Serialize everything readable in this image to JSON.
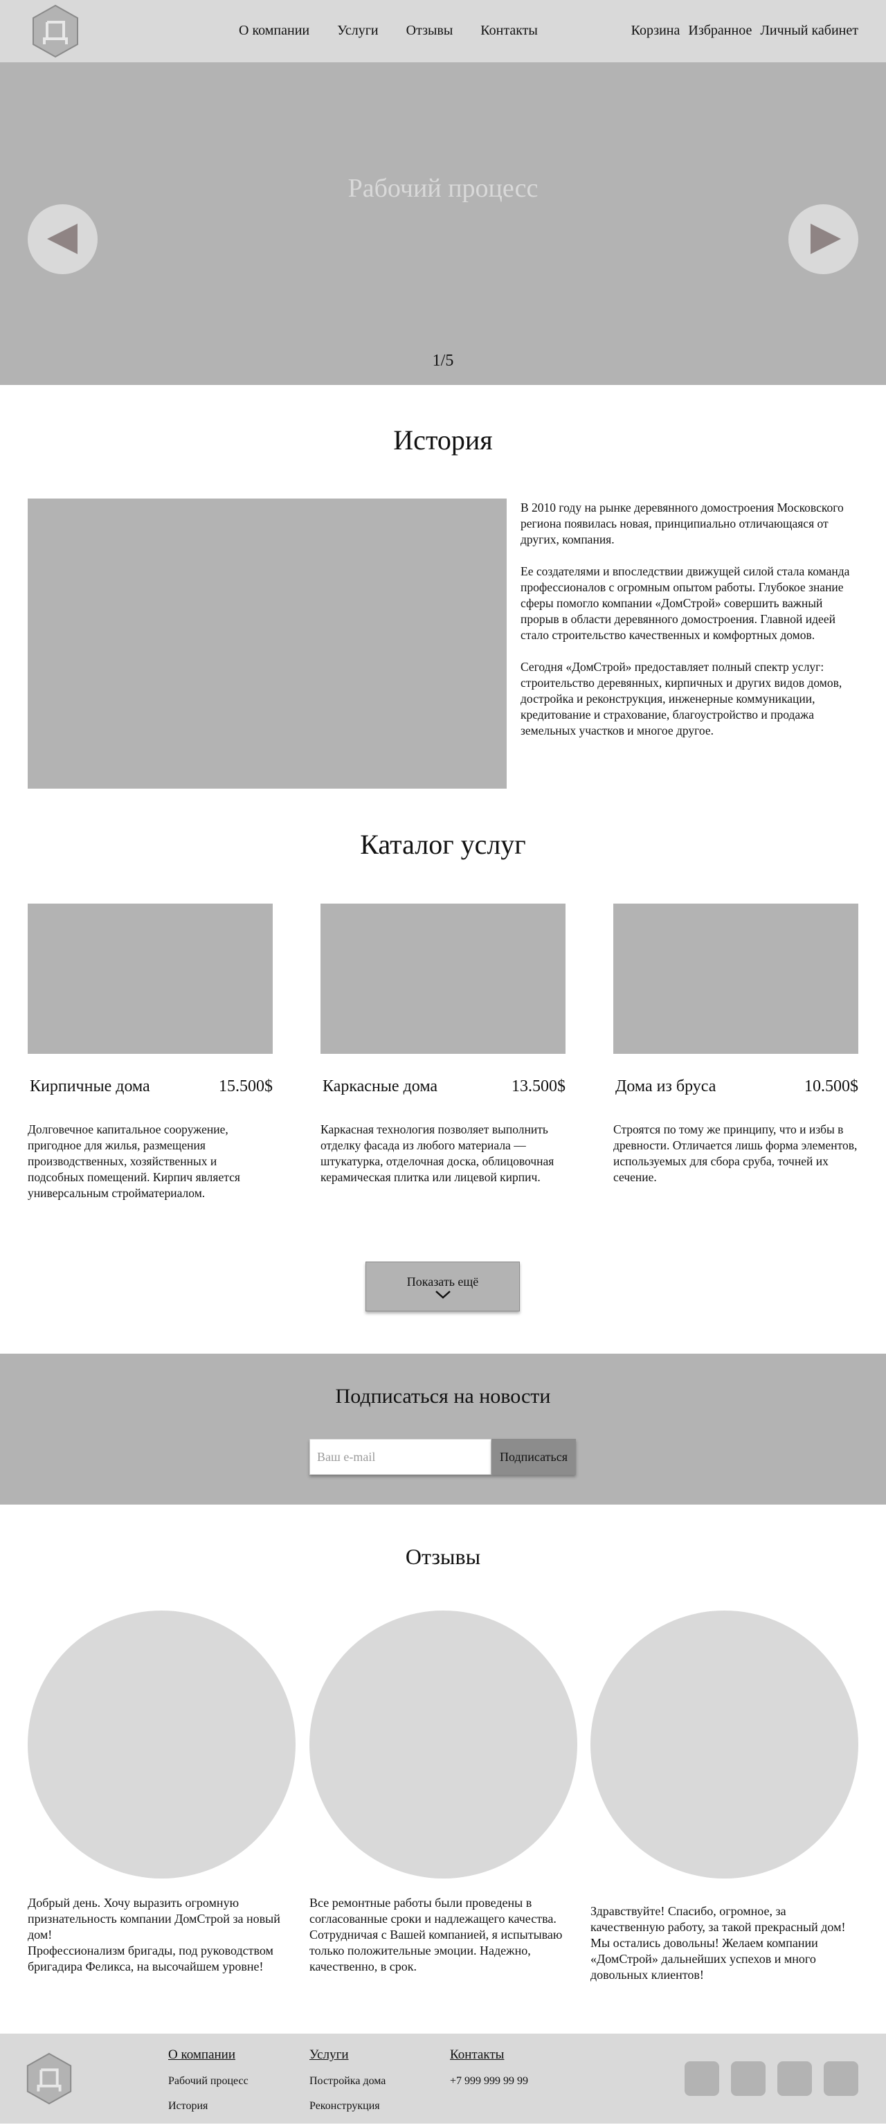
{
  "header": {
    "nav": [
      "О компании",
      "Услуги",
      "Отзывы",
      "Контакты"
    ],
    "user_links": [
      "Корзина",
      "Избранное",
      "Личный кабинет"
    ]
  },
  "hero": {
    "title": "Рабочий процесс",
    "counter": "1/5"
  },
  "history": {
    "title": "История",
    "paragraphs": [
      "В 2010 году на рынке деревянного домостроения Московского региона появилась новая, принципиально отличающаяся от других, компания.",
      "Ее создателями и впоследствии движущей силой стала команда профессионалов с огромным опытом работы. Глубокое знание сферы помогло компании «ДомСтрой» совершить важный прорыв в области деревянного домостроения. Главной идеей стало строительство качественных и комфортных домов.",
      "Сегодня «ДомСтрой» предоставляет полный спектр услуг: строительство деревянных, кирпичных и других видов домов, достройка и реконструкция, инженерные коммуникации, кредитование и страхование, благоустройство и продажа земельных участков и многое другое."
    ]
  },
  "catalog": {
    "title": "Каталог услуг",
    "cards": [
      {
        "name": "Кирпичные дома",
        "price": "15.500$",
        "desc": "Долговечное капитальное сооружение, пригодное для жилья, размещения производственных, хозяйственных и подсобных помещений. Кирпич является универсальным стройматериалом."
      },
      {
        "name": "Каркасные дома",
        "price": "13.500$",
        "desc": "Каркасная технология позволяет выполнить отделку фасада из любого материала — штукатурка, отделочная доска, облицовочная керамическая плитка или лицевой кирпич."
      },
      {
        "name": "Дома из бруса",
        "price": "10.500$",
        "desc": "Строятся по тому же принципу, что и избы в древности. Отличается лишь форма элементов, используемых для сбора сруба, точней их сечение."
      }
    ],
    "more_label": "Показать ещё"
  },
  "subscribe": {
    "title": "Подписаться на новости",
    "placeholder": "Ваш e-mail",
    "button": "Подписаться"
  },
  "reviews": {
    "title": "Отзывы",
    "items": [
      [
        "Добрый день. Хочу выразить огромную признательность компании ДомСтрой за новый дом!",
        "Профессионализм бригады, под руководством бригадира Феликса, на высочайшем уровне!"
      ],
      [
        "Все ремонтные работы были проведены в согласованные сроки и надлежащего качества.",
        "Сотрудничая с Вашей компанией, я испытываю только положительные эмоции. Надежно, качественно, в срок."
      ],
      [
        "Здравствуйте! Спасибо, огромное, за качественную работу, за такой прекрасный дом! Мы остались довольны! Желаем компании «ДомСтрой» дальнейших успехов и много довольных клиентов!"
      ]
    ]
  },
  "footer": {
    "col1": {
      "head": "О компании",
      "items": [
        "Рабочий процесс",
        "История"
      ]
    },
    "col2": {
      "head": "Услуги",
      "items": [
        "Постройка дома",
        "Реконструкция"
      ]
    },
    "col3": {
      "head": "Контакты",
      "items": [
        "+7 999 999 99 99"
      ]
    }
  },
  "icons": {
    "logo": "logo-icon",
    "arrow_left": "arrow-left-icon",
    "arrow_right": "arrow-right-icon",
    "chevron": "chevron-down-icon",
    "social": "social-icon"
  },
  "colors": {
    "header_bg": "#d9d9d9",
    "block_gray": "#b3b3b3",
    "circle_gray": "#d9d9d9",
    "button_dark": "#8c8c8c"
  }
}
